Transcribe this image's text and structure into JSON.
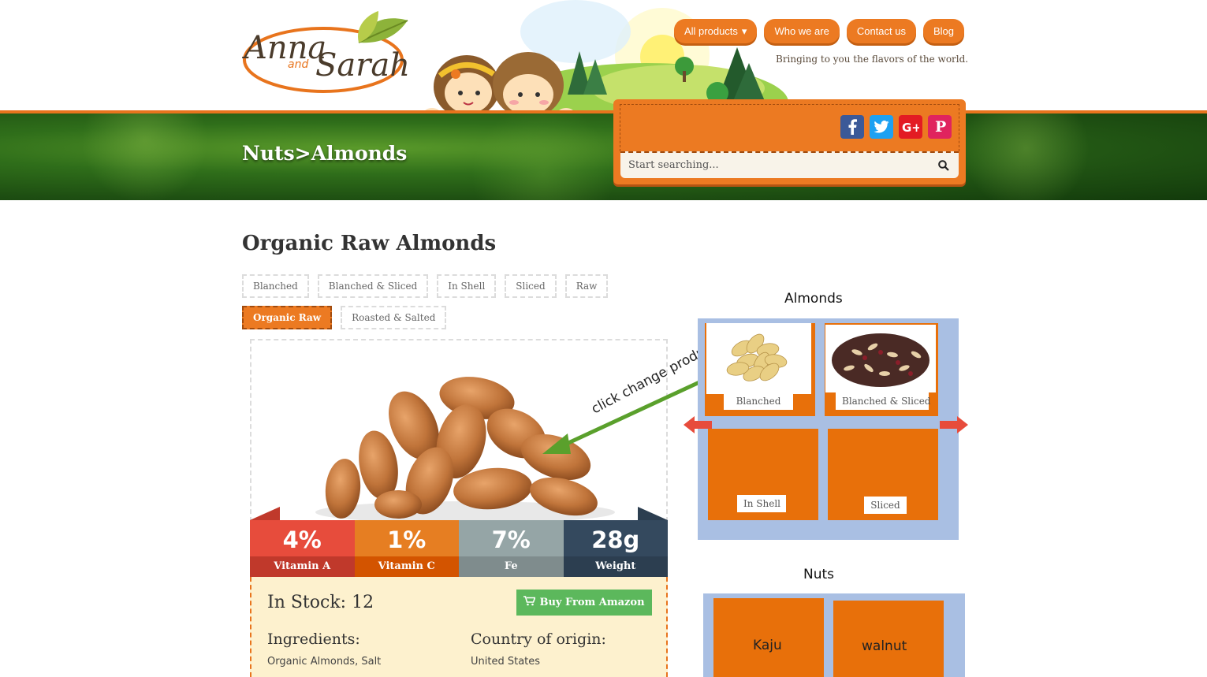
{
  "header": {
    "brand_line1": "Anna",
    "brand_and": "and",
    "brand_line2": "Sarah",
    "nav": [
      {
        "label": "All products",
        "has_dropdown": true
      },
      {
        "label": "Who we are"
      },
      {
        "label": "Contact us"
      },
      {
        "label": "Blog"
      }
    ],
    "tagline": "Bringing to you the flavors of the world.",
    "breadcrumb": "Nuts>Almonds",
    "search": {
      "placeholder": "Start searching..."
    },
    "social": [
      "facebook-icon",
      "twitter-icon",
      "google-plus-icon",
      "pinterest-icon"
    ]
  },
  "product": {
    "title": "Organic Raw Almonds",
    "variants": [
      {
        "label": "Blanched",
        "active": false
      },
      {
        "label": "Blanched & Sliced",
        "active": false
      },
      {
        "label": "In Shell",
        "active": false
      },
      {
        "label": "Sliced",
        "active": false
      },
      {
        "label": "Raw",
        "active": false
      },
      {
        "label": "Organic Raw",
        "active": true
      },
      {
        "label": "Roasted & Salted",
        "active": false
      }
    ],
    "stats": [
      {
        "value": "4%",
        "label": "Vitamin A",
        "color": "#e74c3c",
        "dark": "#c0392b"
      },
      {
        "value": "1%",
        "label": "Vitamin C",
        "color": "#e67e22",
        "dark": "#d35400"
      },
      {
        "value": "7%",
        "label": "Fe",
        "color": "#95a5a6",
        "dark": "#7f8c8d"
      },
      {
        "value": "28g",
        "label": "Weight",
        "color": "#34495e",
        "dark": "#2c3e50"
      }
    ],
    "stock": "In Stock: 12",
    "buy_label": "Buy From Amazon",
    "ingredients_heading": "Ingredients:",
    "ingredients": "Organic Almonds, Salt",
    "origin_heading": "Country of origin:",
    "origin": "United States"
  },
  "annotation": {
    "text": "click change product",
    "color": "#5aa02c"
  },
  "sidebar": {
    "almonds_title": "Almonds",
    "almond_tiles": [
      "Blanched",
      "Blanched & Sliced",
      "In Shell",
      "Sliced"
    ],
    "nuts_title": "Nuts",
    "nut_tiles": [
      "Kaju",
      "walnut"
    ]
  }
}
